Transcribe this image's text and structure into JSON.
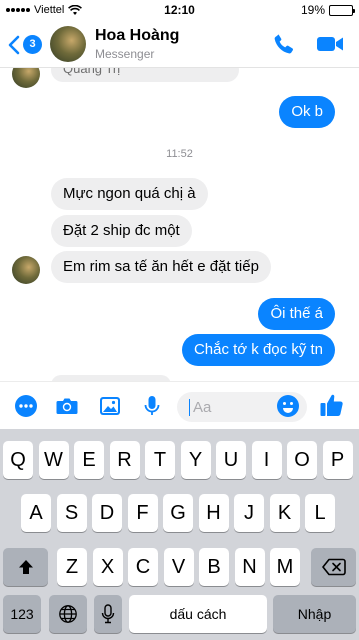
{
  "status_bar": {
    "carrier": "Viettel",
    "time": "12:10",
    "battery": "19%",
    "battery_level": 0.19
  },
  "header": {
    "back_badge": "3",
    "contact_name": "Hoa Hoàng",
    "subtitle": "Messenger",
    "icons": [
      "back-chevron-icon",
      "phone-icon",
      "video-camera-icon"
    ],
    "accent_color": "#0a84ff"
  },
  "chat": {
    "partial_top_message": "Quảng Trị",
    "timestamp": "11:52",
    "messages": [
      {
        "from": "me",
        "text": "Ok b"
      },
      {
        "from": "contact",
        "text": "Mực ngon quá chị à"
      },
      {
        "from": "contact",
        "text": "Đặt 2 ship đc một"
      },
      {
        "from": "contact",
        "text": "Em rim sa tế ăn hết e đặt tiếp"
      },
      {
        "from": "me",
        "text": "Ôi thế á"
      },
      {
        "from": "me",
        "text": "Chắc tớ k đọc kỹ tn"
      }
    ]
  },
  "composer": {
    "placeholder": "Aa",
    "icons": [
      "more-icon",
      "camera-icon",
      "photo-icon",
      "microphone-icon",
      "emoji-icon",
      "thumbs-up-icon"
    ]
  },
  "keyboard": {
    "row1": [
      "Q",
      "W",
      "E",
      "R",
      "T",
      "Y",
      "U",
      "I",
      "O",
      "P"
    ],
    "row2": [
      "A",
      "S",
      "D",
      "F",
      "G",
      "H",
      "J",
      "K",
      "L"
    ],
    "row3": [
      "Z",
      "X",
      "C",
      "V",
      "B",
      "N",
      "M"
    ],
    "numbers_key": "123",
    "space_key": "dấu cách",
    "return_key": "Nhập",
    "icons": [
      "shift-icon",
      "delete-icon",
      "globe-icon",
      "keyboard-mic-icon"
    ]
  }
}
